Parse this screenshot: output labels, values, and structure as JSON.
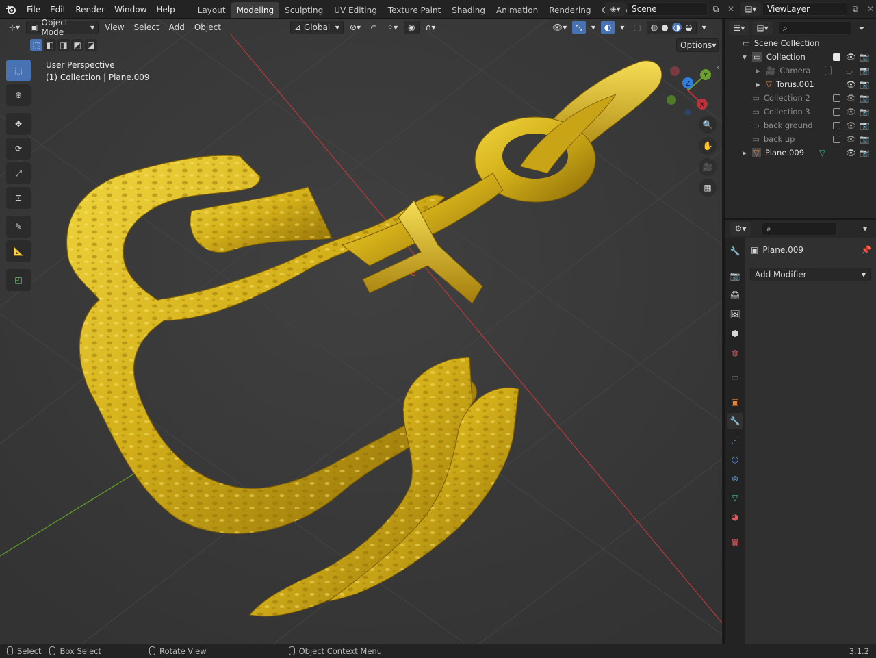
{
  "menu": {
    "file": "File",
    "edit": "Edit",
    "render": "Render",
    "window": "Window",
    "help": "Help"
  },
  "workspaces": [
    "Layout",
    "Modeling",
    "Sculpting",
    "UV Editing",
    "Texture Paint",
    "Shading",
    "Animation",
    "Rendering",
    "Compositing"
  ],
  "active_workspace": "Modeling",
  "scene_name": "Scene",
  "view_layer": "ViewLayer",
  "viewport": {
    "mode": "Object Mode",
    "menus": [
      "View",
      "Select",
      "Add",
      "Object"
    ],
    "orientation": "Global",
    "options_label": "Options",
    "overlay_line1": "User Perspective",
    "overlay_line2": "(1) Collection | Plane.009",
    "gizmo_axes": {
      "z": "Z",
      "y": "Y",
      "x": "X"
    }
  },
  "outliner": {
    "root": "Scene Collection",
    "rows": [
      {
        "label": "Collection",
        "dim": false,
        "checkbox": true,
        "checked": true
      },
      {
        "label": "Camera",
        "dim": true,
        "checkbox": false
      },
      {
        "label": "Torus.001",
        "dim": false,
        "checkbox": false
      },
      {
        "label": "Collection 2",
        "dim": true,
        "checkbox": true,
        "checked": false
      },
      {
        "label": "Collection 3",
        "dim": true,
        "checkbox": true,
        "checked": false
      },
      {
        "label": "back ground",
        "dim": true,
        "checkbox": true,
        "checked": false
      },
      {
        "label": "back up",
        "dim": true,
        "checkbox": true,
        "checked": false
      },
      {
        "label": "Plane.009",
        "dim": false,
        "checkbox": false
      }
    ]
  },
  "properties": {
    "object_name": "Plane.009",
    "add_modifier": "Add Modifier"
  },
  "statusbar": {
    "select": "Select",
    "box_select": "Box Select",
    "rotate_view": "Rotate View",
    "context_menu": "Object Context Menu",
    "version": "3.1.2"
  },
  "colors": {
    "accent_blue": "#4772b3",
    "gold": "#d4b01a",
    "axis_red": "#c0303a",
    "axis_green": "#6aa02e",
    "axis_blue": "#2f7fe0"
  }
}
